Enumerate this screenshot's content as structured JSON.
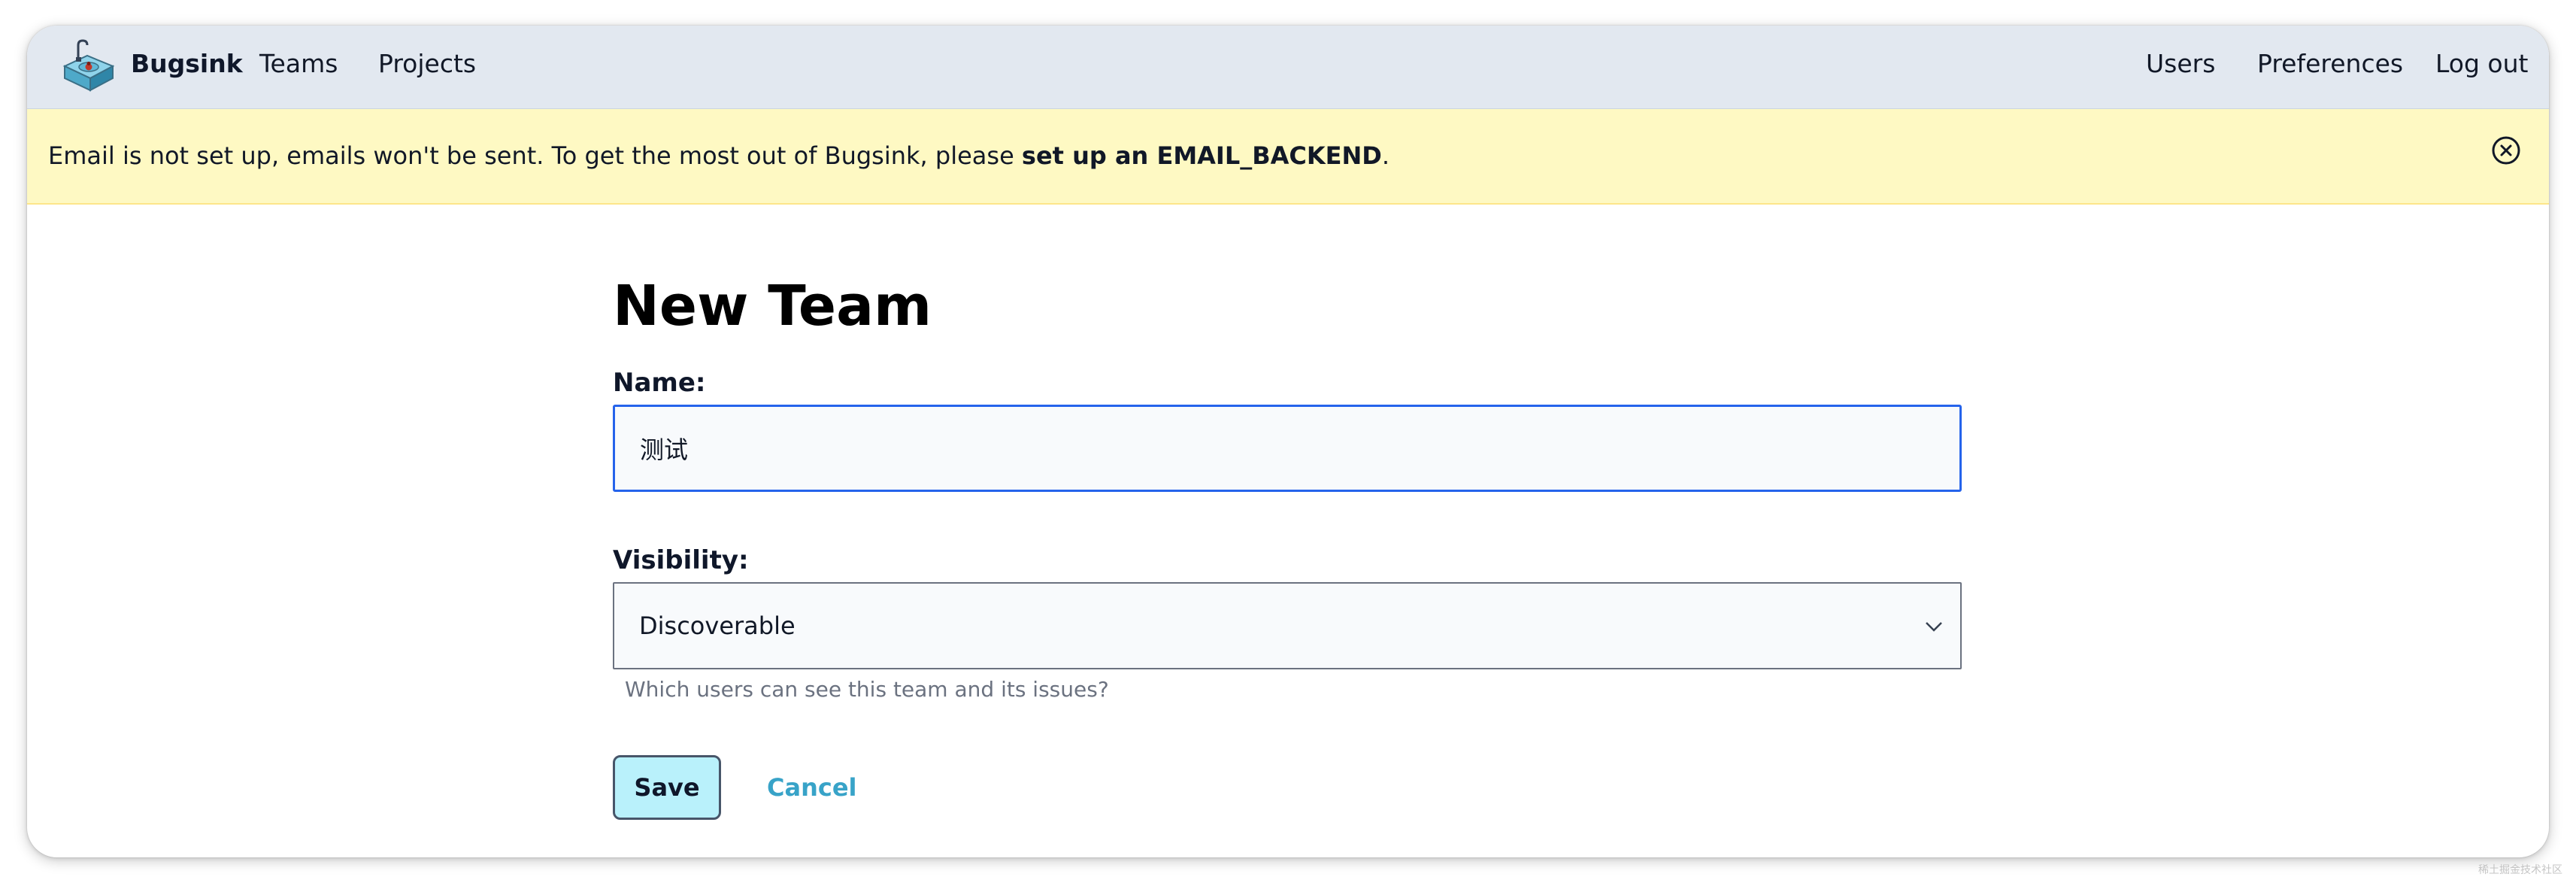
{
  "header": {
    "brand": "Bugsink",
    "nav_left": [
      "Teams",
      "Projects"
    ],
    "nav_right": [
      "Users",
      "Preferences",
      "Log out"
    ]
  },
  "banner": {
    "text_prefix": "Email is not set up, emails won't be sent. To get the most out of Bugsink, please ",
    "link_text": "set up an EMAIL_BACKEND",
    "text_suffix": ".",
    "close_icon": "close-circle-icon"
  },
  "form": {
    "title": "New Team",
    "name_label": "Name:",
    "name_value": "测试",
    "visibility_label": "Visibility:",
    "visibility_value": "Discoverable",
    "visibility_help": "Which users can see this team and its issues?",
    "save_label": "Save",
    "cancel_label": "Cancel"
  },
  "colors": {
    "header_bg": "#e2e8f0",
    "banner_bg": "#fef9c3",
    "input_focus_border": "#2563eb",
    "save_bg": "#b9f1fb",
    "cancel_link": "#38a3c8"
  },
  "watermark": "稀土掘金技术社区"
}
